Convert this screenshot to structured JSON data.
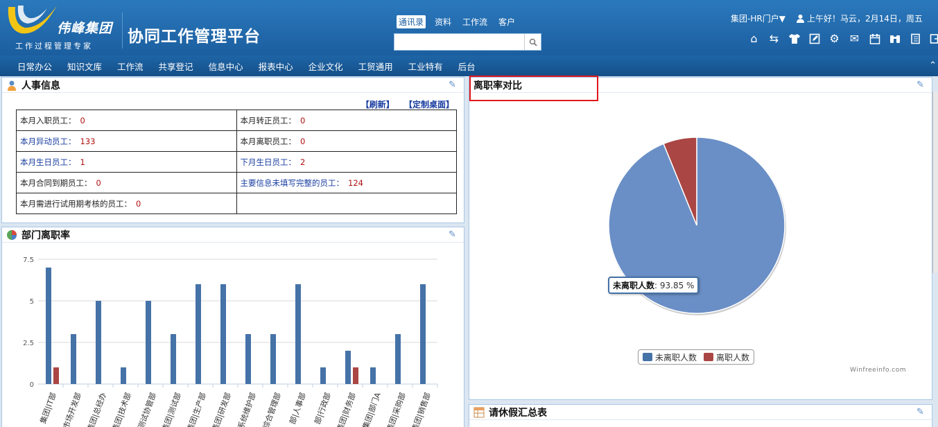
{
  "header": {
    "logo_text": "伟峰集团",
    "logo_sub": "工作过程管理专家",
    "platform_title": "协同工作管理平台",
    "search_tabs": [
      "通讯录",
      "资料",
      "工作流",
      "客户"
    ],
    "search_placeholder": "",
    "portal_label": "集团-HR门户▼",
    "greeting": "上午好！马云，2月14日，周五",
    "toolbar_icons": [
      "home-icon",
      "switch-icon",
      "shirt-icon",
      "edit-icon",
      "gear-icon",
      "mail-icon",
      "calendar-icon",
      "binoculars-icon",
      "book-icon",
      "exit-icon"
    ]
  },
  "nav": {
    "items": [
      "日常办公",
      "知识文库",
      "工作流",
      "共享登记",
      "信息中心",
      "报表中心",
      "企业文化",
      "工贸通用",
      "工业特有",
      "后台"
    ]
  },
  "hr_panel": {
    "title": "人事信息",
    "refresh": "【刷新】",
    "customize": "【定制桌面】",
    "rows": [
      [
        {
          "label": "本月入职员工：",
          "value": "0",
          "link": false
        },
        {
          "label": "本月转正员工：",
          "value": "0",
          "link": false
        }
      ],
      [
        {
          "label": "本月异动员工：",
          "value": "133",
          "link": true
        },
        {
          "label": "本月离职员工：",
          "value": "0",
          "link": false
        }
      ],
      [
        {
          "label": "本月生日员工：",
          "value": "1",
          "link": true
        },
        {
          "label": "下月生日员工：",
          "value": "2",
          "link": true
        }
      ],
      [
        {
          "label": "本月合同到期员工：",
          "value": "0",
          "link": false
        },
        {
          "label": "主要信息未填写完整的员工：",
          "value": "124",
          "link": true
        }
      ],
      [
        {
          "label": "本月需进行试用期考核的员工：",
          "value": "0",
          "link": false
        },
        {
          "label": "",
          "value": "",
          "link": false
        }
      ]
    ]
  },
  "dept_panel": {
    "title": "部门离职率"
  },
  "pie_panel": {
    "title": "离职率对比",
    "tooltip_label": "未离职人数",
    "tooltip_value": ": 93.85 %",
    "credit": "Winfreeinfo.com"
  },
  "leave_panel": {
    "title": "请休假汇总表"
  },
  "colors": {
    "series_blue": "#4572a7",
    "series_red": "#aa4643",
    "pie_blue": "#6a8fc6",
    "highlight": "#e0161b"
  },
  "chart_data": [
    {
      "type": "bar",
      "title": "部门离职率",
      "categories": [
        "集团|IT部",
        "市场开发部",
        "集团|总经办",
        "集团|技术部",
        "测试协管部",
        "集团|测试部",
        "集团|生产部",
        "集团|研发部",
        "系统维护部",
        "综合管理部",
        "部|人事部",
        "部|行政部",
        "集团|财务部",
        "集团|部门A",
        "集团|采购部",
        "集团|销售部"
      ],
      "series": [
        {
          "values": [
            7,
            3,
            5,
            1,
            5,
            3,
            6,
            6,
            3,
            3,
            6,
            1,
            2,
            1,
            3,
            6
          ]
        },
        {
          "values": [
            1,
            0,
            0,
            0,
            0,
            0,
            0,
            0,
            0,
            0,
            0,
            0,
            1,
            0,
            0,
            0
          ]
        }
      ],
      "ylim": [
        0,
        7.5
      ],
      "yticks": [
        "0",
        "2.5",
        "5",
        "7.5"
      ],
      "grid": true
    },
    {
      "type": "pie",
      "title": "离职率对比",
      "slices": [
        {
          "name": "未离职人数",
          "value": 93.85
        },
        {
          "name": "离职人数",
          "value": 6.15
        }
      ],
      "legend": "bottom-center"
    }
  ]
}
